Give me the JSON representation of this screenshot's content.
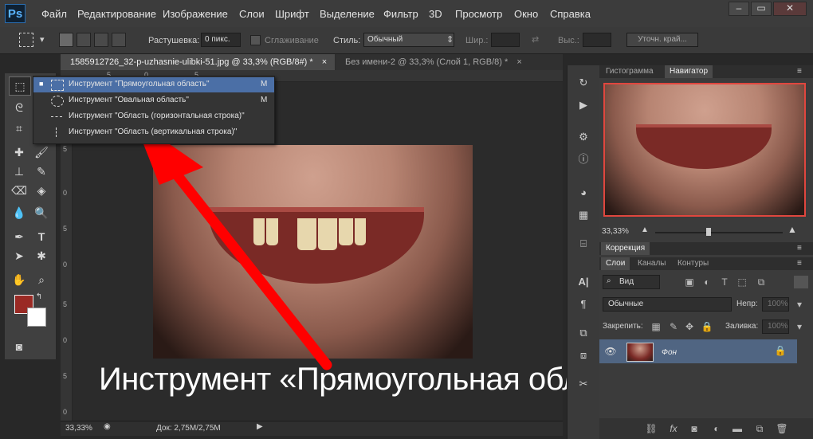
{
  "app": {
    "logo": "Ps"
  },
  "menu": [
    "Файл",
    "Редактирование",
    "Изображение",
    "Слои",
    "Шрифт",
    "Выделение",
    "Фильтр",
    "3D",
    "Просмотр",
    "Окно",
    "Справка"
  ],
  "window_controls": [
    "–",
    "▭",
    "✕"
  ],
  "options": {
    "feather_label": "Растушевка:",
    "feather_value": "0 пикс.",
    "antialias_label": "Сглаживание",
    "style_label": "Стиль:",
    "style_value": "Обычный",
    "width_label": "Шир.:",
    "height_label": "Выс.:",
    "refine_button": "Уточн. край..."
  },
  "tabs": [
    {
      "label": "1585912726_32-p-uzhasnie-ulibki-51.jpg @ 33,3% (RGB/8#) *",
      "close": "×"
    },
    {
      "label": "Без имени-2 @ 33,3% (Слой 1, RGB/8) *",
      "close": "×"
    }
  ],
  "ruler": {
    "top": [
      "5",
      "0",
      "5"
    ],
    "left": [
      "5",
      "0",
      "5",
      "0",
      "5",
      "0",
      "5",
      "0"
    ]
  },
  "flyout": [
    {
      "label": "Инструмент \"Прямоугольная область\"",
      "key": "M"
    },
    {
      "label": "Инструмент \"Овальная область\"",
      "key": "M"
    },
    {
      "label": "Инструмент \"Область (горизонтальная строка)\"",
      "key": ""
    },
    {
      "label": "Инструмент \"Область (вертикальная строка)\"",
      "key": ""
    }
  ],
  "caption": "Инструмент «Прямоугольная область»",
  "status": {
    "zoom": "33,33%",
    "doc": "Док: 2,75М/2,75М"
  },
  "colors": {
    "foreground": "#9a2a24",
    "background": "#ffffff",
    "arrow": "#ff0000",
    "selection": "#4b6fa6"
  },
  "panels": {
    "top_tabs": [
      "Гистограмма",
      "Навигатор"
    ],
    "nav_zoom": "33,33%",
    "correction_tab": "Коррекция",
    "layer_tabs": [
      "Слои",
      "Каналы",
      "Контуры"
    ],
    "kind_filter": "Вид",
    "blend_mode": "Обычные",
    "opacity_label": "Непр:",
    "opacity_value": "100%",
    "lock_label": "Закрепить:",
    "fill_label": "Заливка:",
    "fill_value": "100%",
    "layer_name": "Фон"
  }
}
